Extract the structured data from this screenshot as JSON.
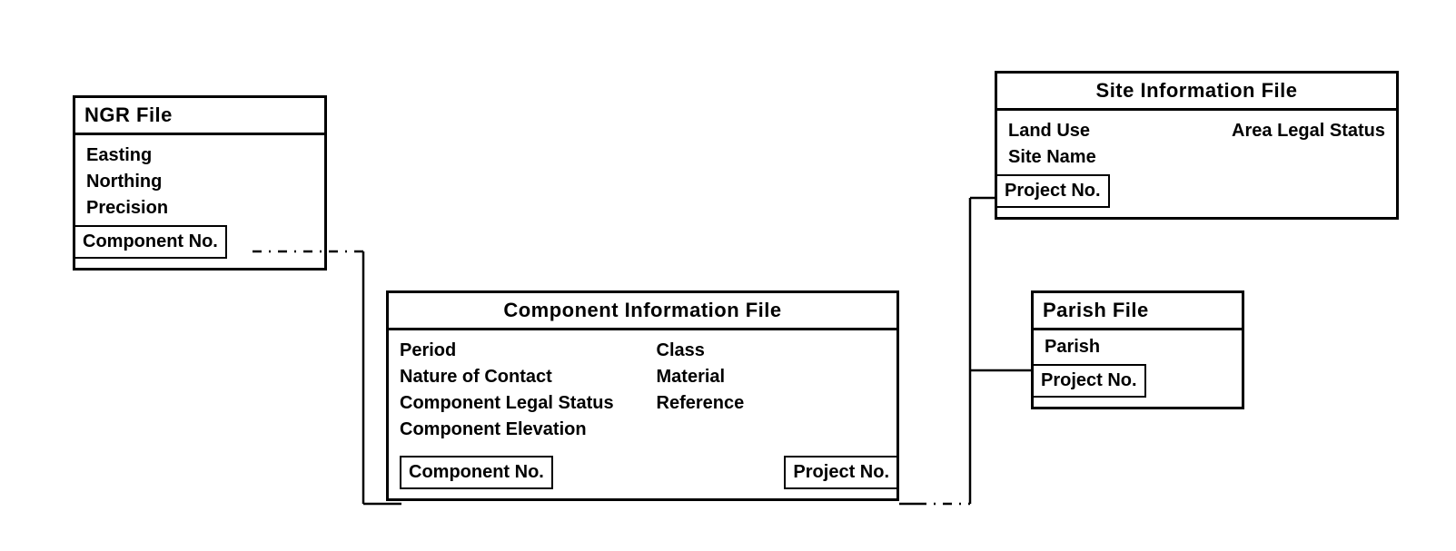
{
  "entities": {
    "ngr": {
      "title": "NGR File",
      "fields": [
        "Easting",
        "Northing",
        "Precision"
      ],
      "key": "Component No."
    },
    "component": {
      "title": "Component Information File",
      "left_fields": [
        "Period",
        "Nature of Contact",
        "Component Legal Status",
        "Component Elevation"
      ],
      "right_fields": [
        "Class",
        "Material",
        "Reference"
      ],
      "key_left": "Component No.",
      "key_right": "Project No."
    },
    "site": {
      "title": "Site Information File",
      "row1_left": "Land Use",
      "row1_right": "Area Legal Status",
      "row2": "Site Name",
      "key": "Project No."
    },
    "parish": {
      "title": "Parish File",
      "field": "Parish",
      "key": "Project No."
    }
  }
}
